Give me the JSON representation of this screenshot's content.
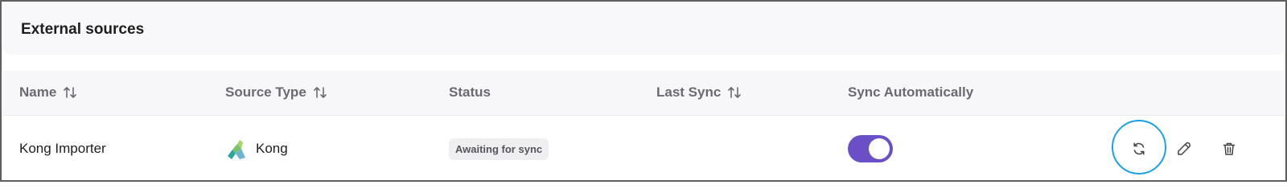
{
  "card": {
    "title": "External sources"
  },
  "table": {
    "columns": [
      {
        "label": "Name",
        "sortable": true
      },
      {
        "label": "Source Type",
        "sortable": true
      },
      {
        "label": "Status",
        "sortable": false
      },
      {
        "label": "Last Sync",
        "sortable": true
      },
      {
        "label": "Sync Automatically",
        "sortable": false
      }
    ],
    "rows": [
      {
        "name": "Kong Importer",
        "source_type": "Kong",
        "source_icon": "kong-logo-icon",
        "status": "Awaiting for sync",
        "last_sync": "",
        "sync_automatically": true,
        "actions": [
          "refresh-icon",
          "edit-icon",
          "trash-icon"
        ]
      }
    ]
  },
  "colors": {
    "toggle_on": "#6b4fc7",
    "highlight_ring": "#1aa2e8",
    "header_bg": "#f7f7f9"
  }
}
